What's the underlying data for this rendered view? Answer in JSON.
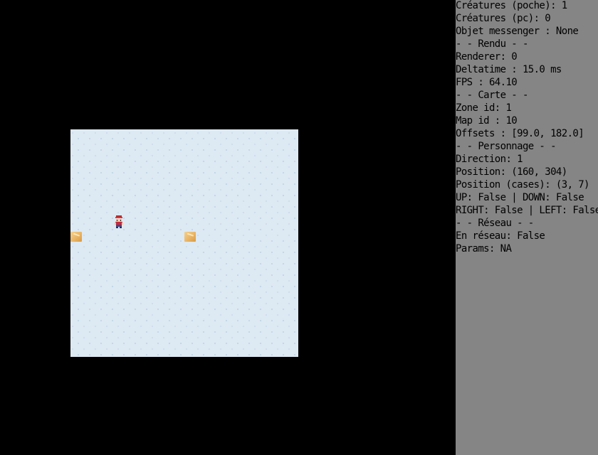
{
  "hud": {
    "lines": [
      "Créatures (poche): 1",
      "Créatures (pc): 0",
      "Objet messenger : None",
      "- - Rendu - -",
      "Renderer: 0",
      "Deltatime : 15.0 ms",
      "FPS : 64.10",
      "- - Carte - -",
      "Zone id: 1",
      "Map id : 10",
      "Offsets : [99.0, 182.0]",
      "- - Personnage - -",
      "Direction: 1",
      "Position: (160, 304)",
      "Position (cases): (3, 7)",
      "UP: False | DOWN: False",
      "RIGHT: False | LEFT: False",
      "- - Réseau - -",
      "En réseau: False",
      "Params: NA"
    ]
  },
  "colors": {
    "background": "#000000",
    "hud_panel": "#858585",
    "map_tile": "#dde9f3",
    "marker": "#e9b466"
  },
  "sprites": [
    "player-sprite",
    "sand-tile-marker"
  ]
}
